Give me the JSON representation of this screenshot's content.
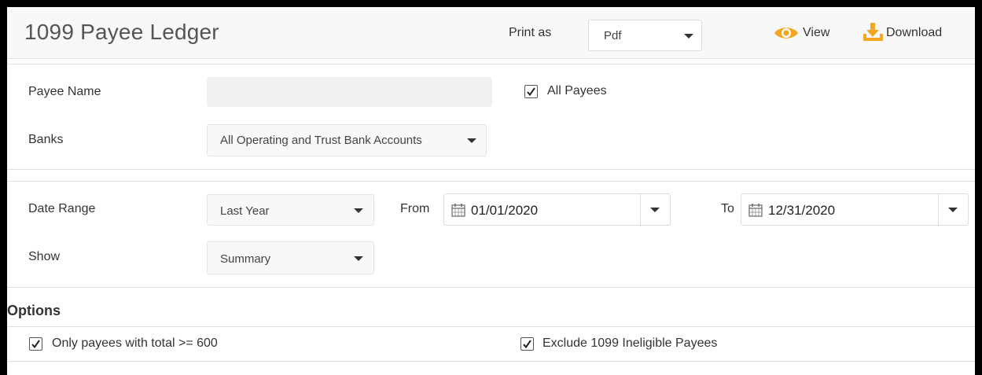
{
  "header": {
    "title": "1099 Payee Ledger",
    "print_as_label": "Print as",
    "print_format": "Pdf",
    "view_label": "View",
    "download_label": "Download",
    "accent_color": "#f5a623"
  },
  "payee": {
    "label": "Payee Name",
    "value": "",
    "all_payees_label": "All Payees",
    "all_payees_checked": true
  },
  "banks": {
    "label": "Banks",
    "value": "All Operating and Trust Bank Accounts"
  },
  "date_range": {
    "label": "Date Range",
    "value": "Last Year",
    "from_label": "From",
    "from_value": "01/01/2020",
    "to_label": "To",
    "to_value": "12/31/2020"
  },
  "show": {
    "label": "Show",
    "value": "Summary"
  },
  "options": {
    "heading": "Options",
    "only_payees_label": "Only payees with total >= 600",
    "only_payees_checked": true,
    "exclude_label": "Exclude 1099 Ineligible Payees",
    "exclude_checked": true
  },
  "icons": [
    "eye-icon",
    "download-icon",
    "calendar-icon",
    "chevron-down-icon",
    "checkmark-icon"
  ]
}
